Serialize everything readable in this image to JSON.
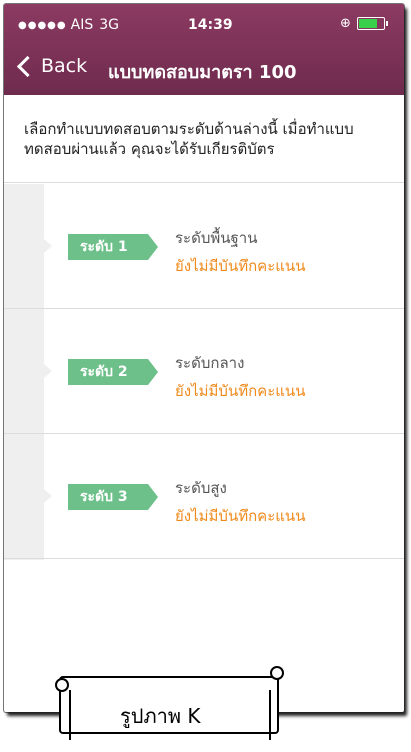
{
  "status_bar": {
    "signal": "●●●●●",
    "carrier": "AIS",
    "network": "3G",
    "time": "14:39"
  },
  "nav": {
    "back_label": "Back",
    "title": "แบบทดสอบมาตรา 100"
  },
  "intro_text": "เลือกทำแบบทดสอบตามระดับด้านล่างนี้ เมื่อทำแบบทดสอบผ่านแล้ว คุณจะได้รับเกียรติบัตร",
  "levels": [
    {
      "badge": "ระดับ 1",
      "title": "ระดับพื้นฐาน",
      "score_status": "ยังไม่มีบันทึกคะแนน"
    },
    {
      "badge": "ระดับ 2",
      "title": "ระดับกลาง",
      "score_status": "ยังไม่มีบันทึกคะแนน"
    },
    {
      "badge": "ระดับ 3",
      "title": "ระดับสูง",
      "score_status": "ยังไม่มีบันทึกคะแนน"
    }
  ],
  "caption": "รูปภาพ K",
  "colors": {
    "header": "#7a3257",
    "badge": "#6dc089",
    "score_text": "#f08a1c"
  }
}
